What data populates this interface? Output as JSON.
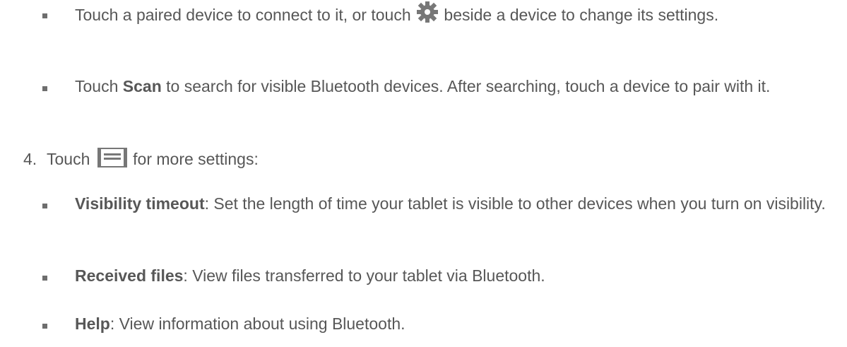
{
  "items": {
    "bullet_paired": {
      "before": "Touch a paired device to connect to it, or touch",
      "icon": "gear-icon",
      "after": "beside a device to change its settings."
    },
    "bullet_scan": {
      "before": "Touch ",
      "bold": "Scan",
      "after": " to search for visible Bluetooth devices. After searching, touch a device to pair with it."
    },
    "step4": {
      "number": "4.",
      "before": "Touch",
      "icon": "menu-icon",
      "after": "for more settings:"
    },
    "bullet_visibility": {
      "bold": "Visibility timeout",
      "after": ": Set the length of time your tablet is visible to other devices when you turn on visibility."
    },
    "bullet_received": {
      "bold": "Received files",
      "after": ": View files transferred to your tablet via Bluetooth."
    },
    "bullet_help": {
      "bold": "Help",
      "after": ": View information about using Bluetooth."
    }
  },
  "colors": {
    "text": "#575757",
    "icon": "#777777"
  }
}
